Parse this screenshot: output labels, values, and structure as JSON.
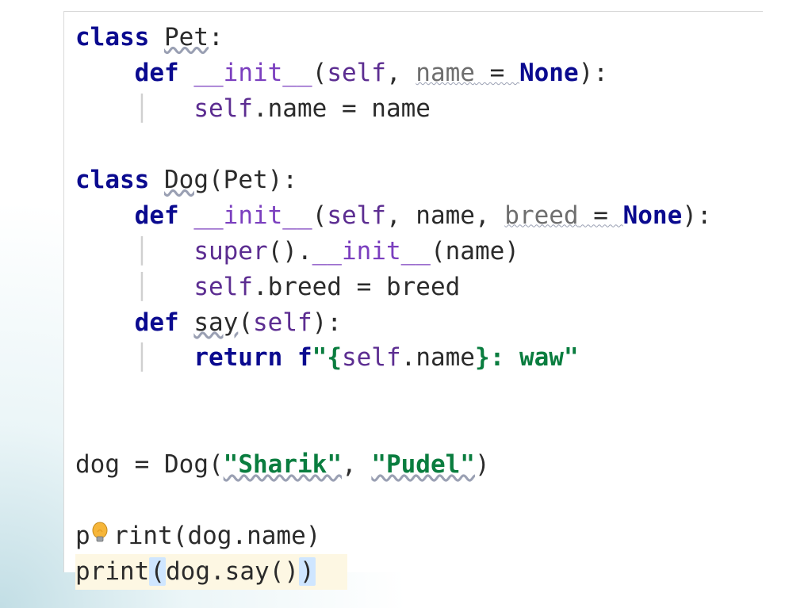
{
  "code": {
    "l1": {
      "kw_class": "class",
      "name": "Pet",
      "colon": ":"
    },
    "l2": {
      "kw_def": "def",
      "dunder": "__init__",
      "open": "(",
      "self": "self",
      "comma": ", ",
      "param": "name",
      "eq": " = ",
      "none": "None",
      "close": "):"
    },
    "l3": {
      "self": "self",
      "dot": ".",
      "attr": "name",
      "eq": " = ",
      "rhs": "name"
    },
    "l4": {
      "blank": ""
    },
    "l5": {
      "kw_class": "class",
      "name": "Dog",
      "open": "(",
      "base": "Pet",
      "close": "):"
    },
    "l6": {
      "kw_def": "def",
      "dunder": "__init__",
      "open": "(",
      "self": "self",
      "c1": ", ",
      "p1": "name",
      "c2": ", ",
      "p2": "breed",
      "eq": " = ",
      "none": "None",
      "close": "):"
    },
    "l7": {
      "super": "super",
      "call": "().",
      "dunder": "__init__",
      "open": "(",
      "arg": "name",
      "close": ")"
    },
    "l8": {
      "self": "self",
      "dot": ".",
      "attr": "breed",
      "eq": " = ",
      "rhs": "breed"
    },
    "l9": {
      "kw_def": "def",
      "name": "say",
      "open": "(",
      "self": "self",
      "close": "):"
    },
    "l10": {
      "kw_return": "return",
      "sp": " ",
      "f": "f",
      "q1": "\"",
      "lb": "{",
      "self": "self",
      "dot": ".",
      "attr": "name",
      "rb": "}",
      "tail": ": waw",
      "q2": "\""
    },
    "l11": {
      "blank": ""
    },
    "l12": {
      "blank": ""
    },
    "l13": {
      "lhs": "dog",
      "eq": " = ",
      "cls": "Dog",
      "open": "(",
      "a1": "\"Sharik\"",
      "comma": ", ",
      "a2": "\"Pudel\"",
      "close": ")"
    },
    "l14": {
      "blank": ""
    },
    "l15": {
      "p": "p",
      "rint": "rint",
      "open": "(",
      "obj": "dog",
      "dot": ".",
      "attr": "name",
      "close": ")"
    },
    "l16": {
      "print": "print",
      "open": "(",
      "obj": "dog",
      "dot": ".",
      "m": "say",
      "call": "()",
      "close": ")"
    }
  },
  "icons": {
    "bulb": "lightbulb-icon"
  },
  "colors": {
    "keyword": "#0a0a8f",
    "dunder": "#7b3fbf",
    "self": "#5c2d91",
    "string": "#0a7d3f",
    "highlight_line": "#fdf7e3",
    "caret_selection": "#cfe6ff"
  }
}
